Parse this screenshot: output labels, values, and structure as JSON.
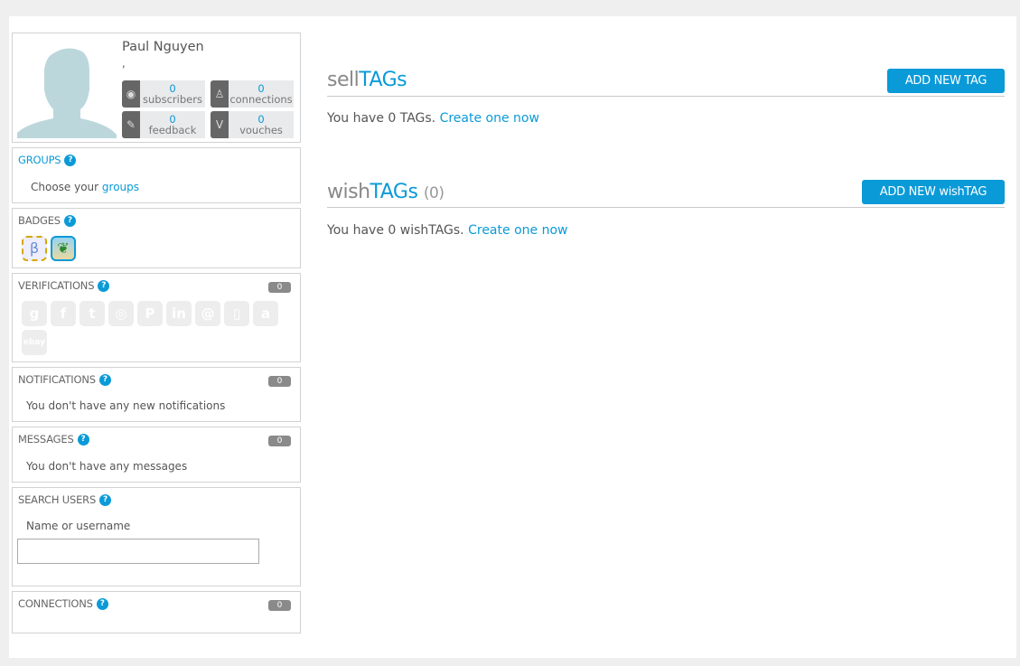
{
  "profile": {
    "name": "Paul Nguyen",
    "subtitle": ",",
    "stats": [
      {
        "icon": "rss-icon",
        "value": "0",
        "label": "subscribers"
      },
      {
        "icon": "person-icon",
        "value": "0",
        "label": "connections"
      },
      {
        "icon": "feedback-icon",
        "value": "0",
        "label": "feedback"
      },
      {
        "icon": "shield-v-icon",
        "value": "0",
        "label": "vouches"
      }
    ]
  },
  "groups": {
    "title": "GROUPS",
    "text": "Choose your ",
    "link": "groups"
  },
  "badges": {
    "title": "BADGES"
  },
  "verifications": {
    "title": "VERIFICATIONS",
    "count": "0",
    "icons": [
      "g",
      "f",
      "t",
      "◎",
      "P",
      "in",
      "@",
      "▯",
      "a",
      "ebay"
    ]
  },
  "notifications": {
    "title": "NOTIFICATIONS",
    "count": "0",
    "text": "You don't have any new notifications"
  },
  "messages": {
    "title": "MESSAGES",
    "count": "0",
    "text": "You don't have any messages"
  },
  "search_users": {
    "title": "SEARCH USERS",
    "label": "Name or username",
    "value": ""
  },
  "connections": {
    "title": "CONNECTIONS",
    "count": "0"
  },
  "sell": {
    "title_a": "sell",
    "title_b": "TAGs",
    "button": "ADD NEW TAG",
    "text": "You have 0 TAGs. ",
    "link": "Create one now"
  },
  "wish": {
    "title_a": "wish",
    "title_b": "TAGs",
    "count": "(0)",
    "button": "ADD NEW wishTAG",
    "text": "You have 0 wishTAGs. ",
    "link": "Create one now"
  },
  "help_glyph": "?"
}
